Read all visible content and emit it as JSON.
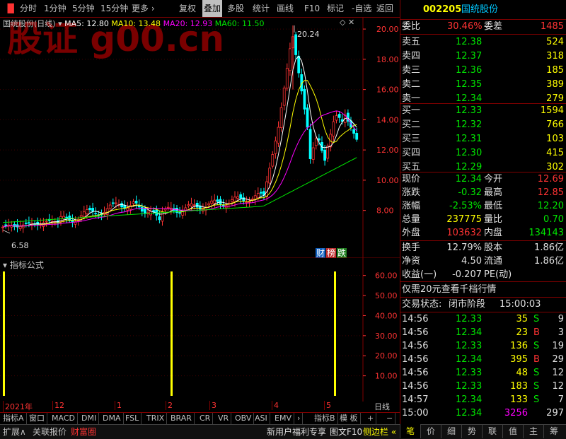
{
  "toolbar": {
    "items": [
      "分时",
      "1分钟",
      "5分钟",
      "15分钟",
      "更多 ›",
      "复权",
      "叠加",
      "多股",
      "统计",
      "画线",
      "F10",
      "标记",
      "-自选",
      "返回"
    ],
    "active_index": 6
  },
  "watermark": "股证 g00.cn",
  "main": {
    "stock_name": "国统股份(日线)",
    "ma5": "MA5: 12.80",
    "ma10": "MA10: 13.48",
    "ma20": "MA20: 12.93",
    "ma60": "MA60: 11.50",
    "max_label": "20.24",
    "min_label": "6.58",
    "badges": [
      "财",
      "榜",
      "跌"
    ],
    "y_ticks": [
      "20.00",
      "18.00",
      "16.00",
      "14.00",
      "12.00",
      "10.00",
      "8.00"
    ],
    "colors": {
      "ma5": "#ffffff",
      "ma10": "#ffff00",
      "ma20": "#ff00ff",
      "ma60": "#00e600",
      "up": "#ff3333",
      "down": "#00ffff"
    }
  },
  "indicator": {
    "title": "指标公式",
    "y_ticks": [
      "60.00",
      "50.00",
      "40.00",
      "30.00",
      "20.00",
      "10.00"
    ],
    "color": "#ffff00"
  },
  "x_axis": {
    "labels": [
      "2021年",
      "12",
      "1",
      "2",
      "3",
      "4",
      "5"
    ],
    "right_label": "日线"
  },
  "tabs": {
    "items": [
      "指标A",
      "窗口",
      "MACD",
      "DMI",
      "DMA",
      "FSL",
      "TRIX",
      "BRAR",
      "CR",
      "VR",
      "OBV",
      "ASI",
      "EMV",
      "›",
      "指标B",
      "模 板",
      "+",
      "−"
    ]
  },
  "bottom": {
    "items": [
      "扩展∧",
      "关联报价",
      "财富圈"
    ],
    "right_items": [
      "新用户福利专享",
      "图文F10",
      "侧边栏 «"
    ]
  },
  "quote": {
    "code": "002205",
    "name": "国统股份",
    "weibi_label": "委比",
    "weibi": "30.46%",
    "weicha_label": "委差",
    "weicha": "1485",
    "asks": [
      {
        "label": "卖五",
        "price": "12.38",
        "vol": "524"
      },
      {
        "label": "卖四",
        "price": "12.37",
        "vol": "318"
      },
      {
        "label": "卖三",
        "price": "12.36",
        "vol": "185"
      },
      {
        "label": "卖二",
        "price": "12.35",
        "vol": "389"
      },
      {
        "label": "卖一",
        "price": "12.34",
        "vol": "279"
      }
    ],
    "bids": [
      {
        "label": "买一",
        "price": "12.33",
        "vol": "1594"
      },
      {
        "label": "买二",
        "price": "12.32",
        "vol": "766"
      },
      {
        "label": "买三",
        "price": "12.31",
        "vol": "103"
      },
      {
        "label": "买四",
        "price": "12.30",
        "vol": "415"
      },
      {
        "label": "买五",
        "price": "12.29",
        "vol": "302"
      }
    ],
    "stats": [
      {
        "l1": "现价",
        "v1": "12.34",
        "c1": "green",
        "l2": "今开",
        "v2": "12.69",
        "c2": "red"
      },
      {
        "l1": "涨跌",
        "v1": "-0.32",
        "c1": "green",
        "l2": "最高",
        "v2": "12.85",
        "c2": "red"
      },
      {
        "l1": "涨幅",
        "v1": "-2.53%",
        "c1": "green",
        "l2": "最低",
        "v2": "12.20",
        "c2": "green"
      },
      {
        "l1": "总量",
        "v1": "237775",
        "c1": "yellow",
        "l2": "量比",
        "v2": "0.70",
        "c2": "green"
      },
      {
        "l1": "外盘",
        "v1": "103632",
        "c1": "red",
        "l2": "内盘",
        "v2": "134143",
        "c2": "green"
      }
    ],
    "stats2": [
      {
        "l1": "换手",
        "v1": "12.79%",
        "l2": "股本",
        "v2": "1.86亿"
      },
      {
        "l1": "净资",
        "v1": "4.50",
        "l2": "流通",
        "v2": "1.86亿"
      },
      {
        "l1": "收益(一)",
        "v1": "-0.207",
        "l2": "PE(动)",
        "v2": ""
      }
    ],
    "promo": "仅需20元查看千档行情",
    "status_label": "交易状态:",
    "status": "闭市阶段",
    "status_time": "15:00:03",
    "ticks": [
      {
        "t": "14:56",
        "p": "12.33",
        "v": "35",
        "bs": "S",
        "n": "9"
      },
      {
        "t": "14:56",
        "p": "12.34",
        "v": "23",
        "bs": "B",
        "n": "3"
      },
      {
        "t": "14:56",
        "p": "12.33",
        "v": "136",
        "bs": "S",
        "n": "19"
      },
      {
        "t": "14:56",
        "p": "12.34",
        "v": "395",
        "bs": "B",
        "n": "29"
      },
      {
        "t": "14:56",
        "p": "12.33",
        "v": "48",
        "bs": "S",
        "n": "12"
      },
      {
        "t": "14:56",
        "p": "12.33",
        "v": "183",
        "bs": "S",
        "n": "12"
      },
      {
        "t": "14:57",
        "p": "12.34",
        "v": "133",
        "bs": "S",
        "n": "7"
      },
      {
        "t": "15:00",
        "p": "12.34",
        "v": "3256",
        "bs": "",
        "n": "297"
      }
    ]
  },
  "right_tabs": [
    "笔",
    "价",
    "细",
    "势",
    "联",
    "值",
    "主",
    "筹"
  ],
  "right_tabs_active": 0
}
